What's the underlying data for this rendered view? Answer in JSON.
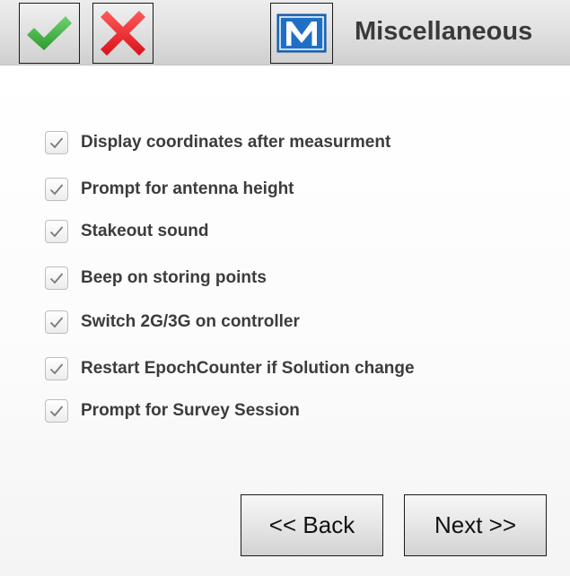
{
  "header": {
    "title": "Miscellaneous",
    "ok_icon": "checkmark-icon",
    "cancel_icon": "cross-icon",
    "logo_letter": "M",
    "colors": {
      "ok": "#3aa83a",
      "cancel": "#e8212b",
      "logo": "#1f6fc5"
    }
  },
  "options": [
    {
      "label": "Display coordinates after measurment",
      "checked": true
    },
    {
      "label": "Prompt for antenna height",
      "checked": true
    },
    {
      "label": "Stakeout sound",
      "checked": true
    },
    {
      "label": "Beep on storing points",
      "checked": true
    },
    {
      "label": "Switch 2G/3G on controller",
      "checked": true
    },
    {
      "label": "Restart EpochCounter if Solution change",
      "checked": true
    },
    {
      "label": "Prompt for Survey Session",
      "checked": true
    }
  ],
  "nav": {
    "back_label": "<< Back",
    "next_label": "Next >>"
  }
}
